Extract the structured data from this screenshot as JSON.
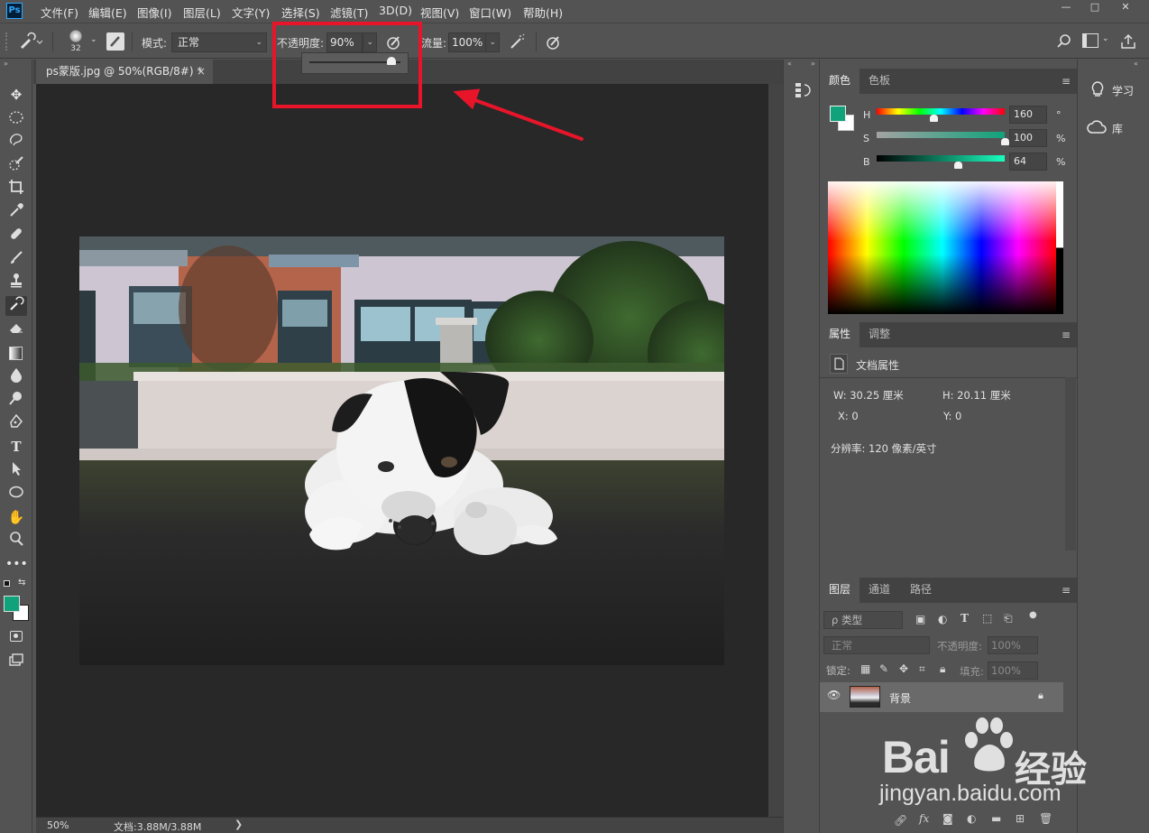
{
  "app": {
    "logo_text": "Ps"
  },
  "menu": {
    "items": [
      "文件(F)",
      "编辑(E)",
      "图像(I)",
      "图层(L)",
      "文字(Y)",
      "选择(S)",
      "滤镜(T)",
      "3D(D)",
      "视图(V)",
      "窗口(W)",
      "帮助(H)"
    ]
  },
  "window_controls": {
    "minimize": "—",
    "restore": "□",
    "close": "✕"
  },
  "options_bar": {
    "brush_size": "32",
    "mode_label": "模式:",
    "mode_value": "正常",
    "opacity_label": "不透明度:",
    "opacity_value": "90%",
    "flow_label": "流量:",
    "flow_value": "100%"
  },
  "opacity_popup": {
    "level": 0.9
  },
  "document": {
    "tab_title": "ps蒙版.jpg @ 50%(RGB/8#) *",
    "tab_close": "×",
    "zoom": "50%",
    "doc_size": "文档:3.88M/3.88M",
    "status_arrow": "❯"
  },
  "color_panel": {
    "tabs": [
      "颜色",
      "色板"
    ],
    "foreground": "#10a37b",
    "background": "#ffffff",
    "h": {
      "label": "H",
      "value": "160",
      "unit": "°"
    },
    "s": {
      "label": "S",
      "value": "100",
      "unit": "%"
    },
    "b": {
      "label": "B",
      "value": "64",
      "unit": "%"
    }
  },
  "properties_panel": {
    "tabs": [
      "属性",
      "调整"
    ],
    "title": "文档属性",
    "w": "W:  30.25  厘米",
    "h": "H:  20.11  厘米",
    "x": "X:  0",
    "y": "Y:  0",
    "resolution": "分辨率: 120 像素/英寸"
  },
  "layers_panel": {
    "tabs": [
      "图层",
      "通道",
      "路径"
    ],
    "filter_kind": "ρ 类型",
    "blend_mode": "正常",
    "opacity_label": "不透明度:",
    "opacity_value": "100%",
    "lock_label": "锁定:",
    "fill_label": "填充:",
    "fill_value": "100%",
    "layers": [
      {
        "name": "背景",
        "visible": true,
        "locked": true
      }
    ]
  },
  "learn_panel": {
    "learn": "学习",
    "library": "库"
  },
  "watermark": {
    "brand_a": "Bai",
    "brand_b": "经验",
    "url": "jingyan.baidu.com"
  }
}
